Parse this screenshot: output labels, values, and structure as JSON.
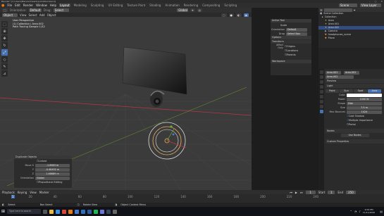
{
  "window": {
    "title": "Blender* [C:\\Users\\Blender\\Desktop\\Untitled.blend]"
  },
  "topbar": {
    "menus": [
      "File",
      "Edit",
      "Render",
      "Window",
      "Help"
    ],
    "workspaces": [
      "Layout",
      "Modeling",
      "Sculpting",
      "UV Editing",
      "Texture Paint",
      "Shading",
      "Animation",
      "Rendering",
      "Compositing",
      "Scripting"
    ],
    "active_workspace": "Layout",
    "scene": "Scene",
    "view_layer": "View Layer"
  },
  "viewport_header": {
    "orientation_label": "Orientation:",
    "orientation_value": "Default",
    "drag_label": "Drag:",
    "drag_value": "Select Box",
    "mode": "Object Mode",
    "menus": [
      "View",
      "Select",
      "Add",
      "Object"
    ],
    "transform": "Global"
  },
  "viewport_info": {
    "line1": "User Perspective",
    "line2": "(1) Collection | Area.002",
    "line3": "Path Tracing Sample 1/32"
  },
  "npanel": {
    "active_tool_header": "Active Tool",
    "scale_label": "Scale",
    "orientation_label": "Orientation",
    "orientation_value": "Default",
    "drag_label": "Drag",
    "drag_value": "Select Box",
    "options_header": "Options",
    "transform_header": "Transform",
    "affect_only_label": "Affect Only",
    "origins": "Origins",
    "locations": "Locations",
    "parents": "Parents",
    "workspace_header": "Workspace"
  },
  "redo_panel": {
    "title": "Duplicate Objects",
    "linked_label": "Linked",
    "move_x_label": "Move X",
    "move_x_value": "-1.8963 m",
    "move_y_label": "Y",
    "move_y_value": "-0.48452 m",
    "move_z_label": "Z",
    "move_z_value": "1.68689 m",
    "orientation_label": "Orientation",
    "orientation_value": "Global",
    "proportional_label": "Proportional Editing"
  },
  "outliner": {
    "title": "Scene Collection",
    "items": [
      {
        "label": "Collection",
        "indent": 1,
        "selected": false
      },
      {
        "label": "Area",
        "indent": 2,
        "selected": false
      },
      {
        "label": "Area.001",
        "indent": 2,
        "selected": false
      },
      {
        "label": "Area.002",
        "indent": 2,
        "selected": true
      },
      {
        "label": "Camera",
        "indent": 2,
        "selected": false
      },
      {
        "label": "headphones_scene",
        "indent": 2,
        "selected": false
      },
      {
        "label": "Plane",
        "indent": 2,
        "selected": false
      }
    ]
  },
  "properties": {
    "object_name": "Area.002",
    "data_name": "Area.002",
    "data_field": "Area.002",
    "preview_header": "Preview",
    "light_header": "Light",
    "light_types": [
      "Point",
      "Sun",
      "Spot",
      "Area"
    ],
    "active_light_type": "Area",
    "color_label": "Color",
    "power_label": "Power",
    "power_value": "1000 W",
    "shape_label": "Shape",
    "shape_value": "Disk",
    "size_label": "Size",
    "size_value": "7.5 m",
    "max_bounces_label": "Max Bounces",
    "max_bounces_value": "1024",
    "cast_shadow_label": "Cast Shadow",
    "multiple_importance_label": "Multiple Importance",
    "portal_label": "Portal",
    "nodes_header": "Nodes",
    "use_nodes_label": "Use Nodes",
    "custom_props_header": "Custom Properties"
  },
  "timeline": {
    "menus": [
      "Playback",
      "Keying",
      "View",
      "Marker"
    ],
    "current_frame": "1",
    "start_label": "Start",
    "start_value": "1",
    "end_label": "End",
    "end_value": "250",
    "ticks": [
      "0",
      "20",
      "40",
      "60",
      "80",
      "100",
      "120",
      "140",
      "160",
      "180",
      "200",
      "220",
      "240"
    ]
  },
  "statusbar": {
    "hint1": "Select",
    "hint2": "Box Select",
    "hint3": "Rotate View",
    "hint4": "Object Context Menu"
  },
  "taskbar": {
    "search_placeholder": "Type here to search",
    "time": "2:09 PM",
    "date": "11/11/2020"
  },
  "colors": {
    "accent": "#4772b3",
    "viewport_bg": "#3a3a3a",
    "x_axis": "#b23a48",
    "y_axis": "#6c9a2c"
  }
}
